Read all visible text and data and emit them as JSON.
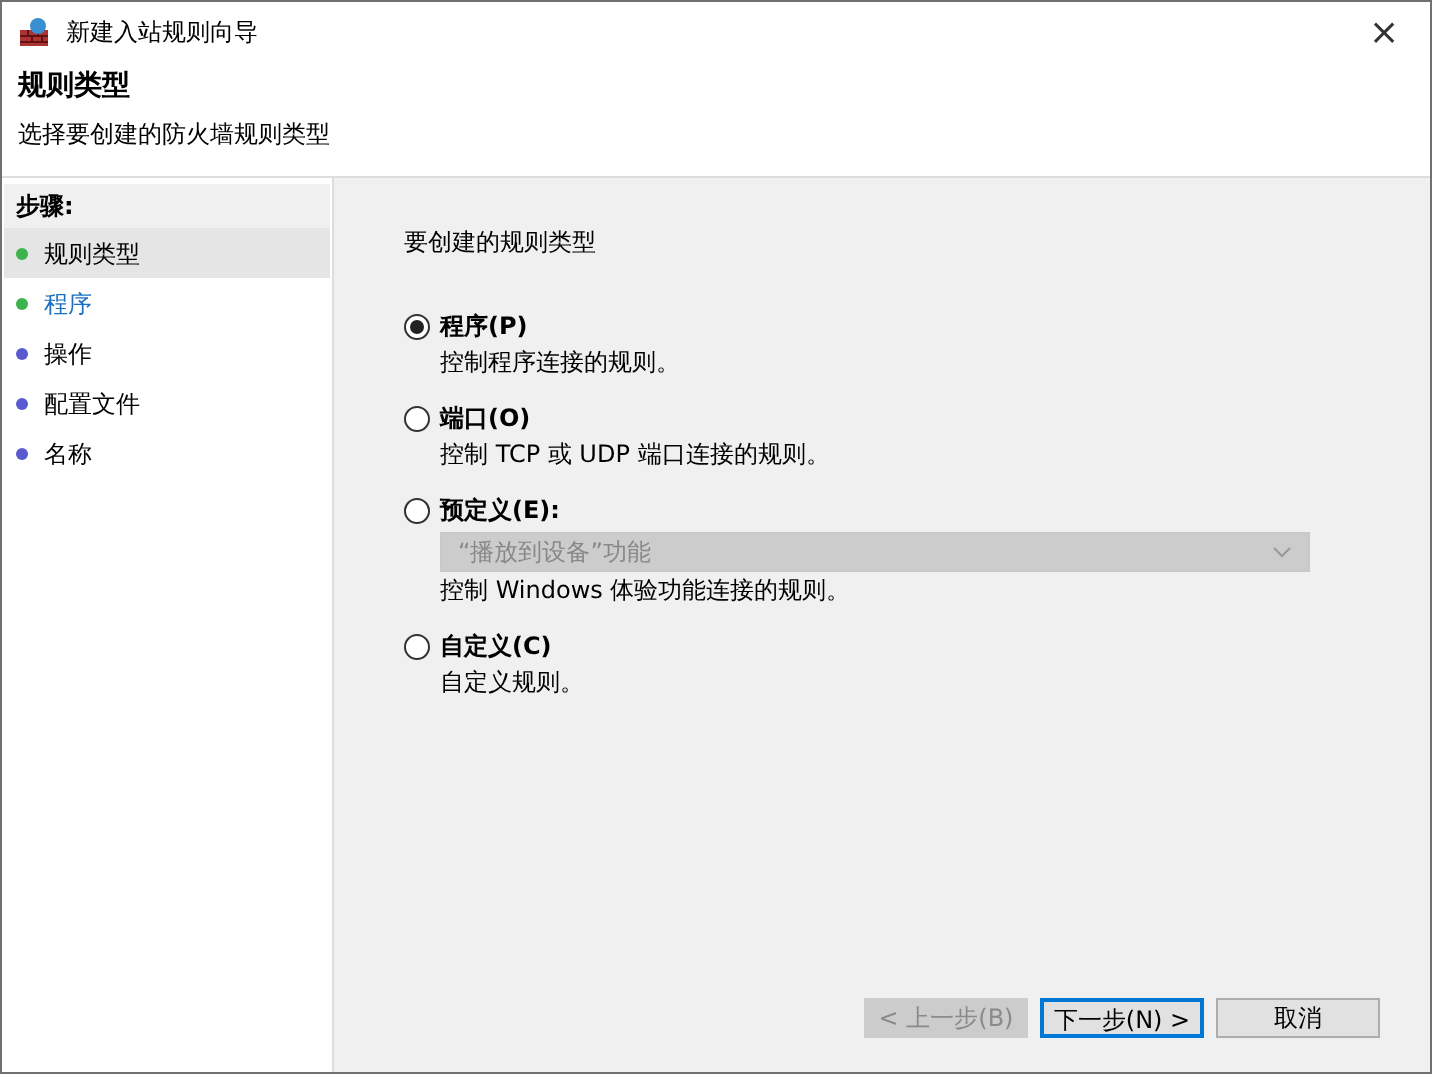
{
  "window": {
    "title": "新建入站规则向导",
    "close": "×"
  },
  "header": {
    "title": "规则类型",
    "subtitle": "选择要创建的防火墙规则类型"
  },
  "steps_label": "步骤:",
  "steps": [
    {
      "label": "规则类型",
      "selected": true,
      "hover": false,
      "color": "#3cb44b"
    },
    {
      "label": "程序",
      "selected": false,
      "hover": true,
      "color": "#3cb44b"
    },
    {
      "label": "操作",
      "selected": false,
      "hover": false,
      "color": "#5a5ad0"
    },
    {
      "label": "配置文件",
      "selected": false,
      "hover": false,
      "color": "#5a5ad0"
    },
    {
      "label": "名称",
      "selected": false,
      "hover": false,
      "color": "#5a5ad0"
    }
  ],
  "prompt": "要创建的规则类型",
  "options": [
    {
      "kind": "plain",
      "label": "程序(P)",
      "description": "控制程序连接的规则。",
      "selected": true
    },
    {
      "kind": "plain",
      "label": "端口(O)",
      "description": "控制 TCP 或 UDP 端口连接的规则。",
      "selected": false
    },
    {
      "kind": "dropdown",
      "label": "预定义(E):",
      "dropdown": {
        "value": "“播放到设备”功能",
        "disabled": true
      },
      "description": "控制 Windows 体验功能连接的规则。",
      "selected": false
    },
    {
      "kind": "plain",
      "label": "自定义(C)",
      "description": "自定义规则。",
      "selected": false
    }
  ],
  "buttons": [
    {
      "label": "< 上一步(B)",
      "disabled": true,
      "default": false
    },
    {
      "label": "下一步(N) >",
      "disabled": false,
      "default": true
    },
    {
      "label": "取消",
      "disabled": false,
      "default": false
    }
  ]
}
